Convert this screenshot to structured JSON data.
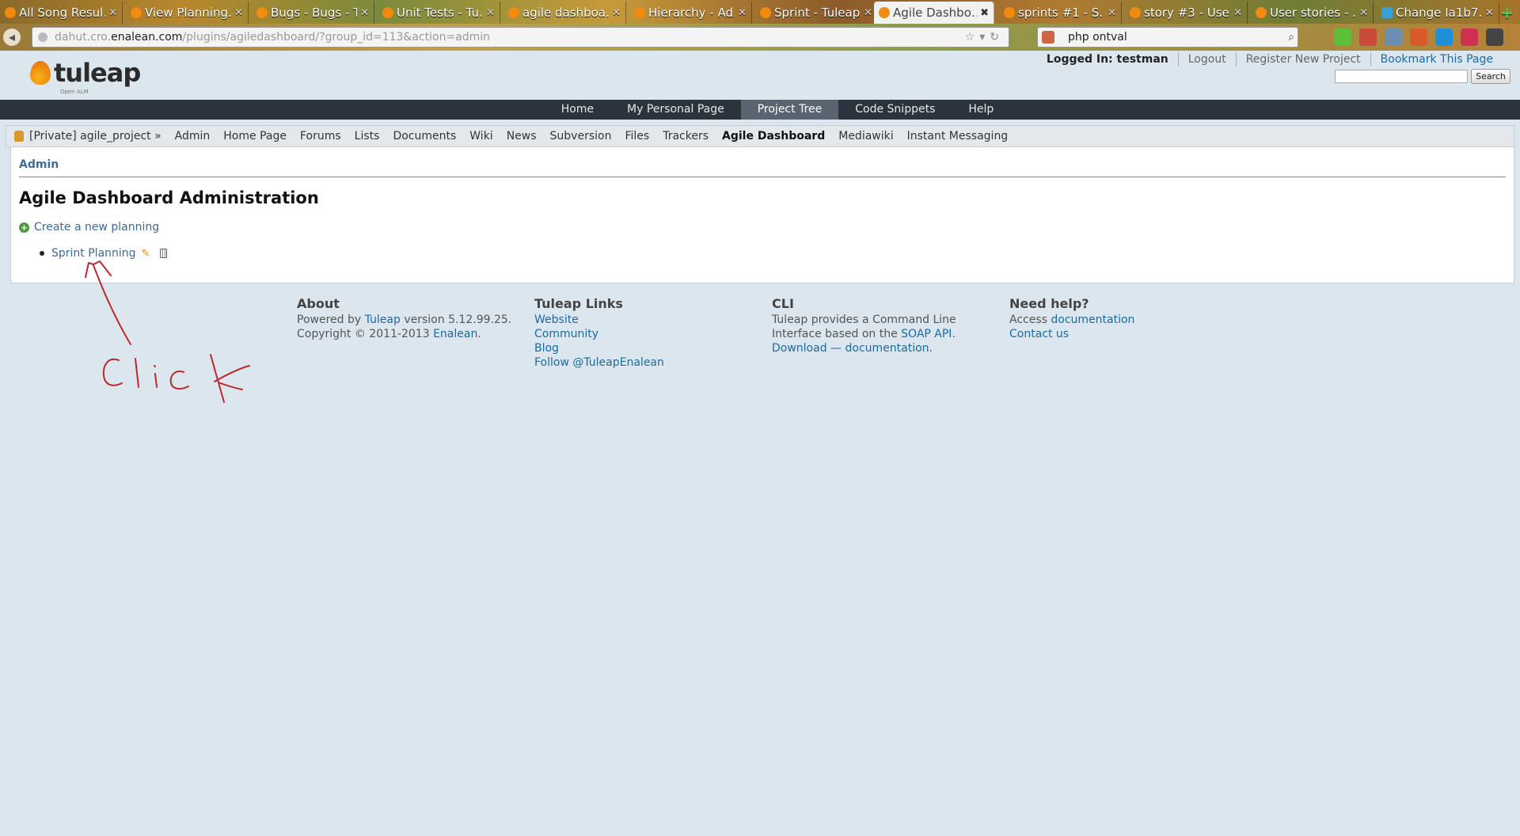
{
  "browser": {
    "tabs": [
      {
        "label": "All Song Resul…"
      },
      {
        "label": "View Planning…"
      },
      {
        "label": "Bugs - Bugs - T…"
      },
      {
        "label": "Unit Tests - Tu…"
      },
      {
        "label": "agile dashboa…"
      },
      {
        "label": "Hierarchy - Ad…"
      },
      {
        "label": "Sprint - Tuleap"
      },
      {
        "label": "Agile Dashbo…",
        "active": true
      },
      {
        "label": "sprints #1 - S…"
      },
      {
        "label": "story #3 - Use…"
      },
      {
        "label": "User stories - …"
      },
      {
        "label": "Change Ia1b7…"
      }
    ],
    "url": {
      "pre": "dahut.cro.",
      "domain": "enalean.com",
      "path": "/plugins/agiledashboard/?group_id=113&action=admin"
    },
    "search_query": "php ontval"
  },
  "header": {
    "logo_text": "tuleap",
    "logo_tagline": "Open ALM",
    "logged_in": "Logged In: testman",
    "logout": "Logout",
    "register": "Register New Project",
    "bookmark": "Bookmark This Page",
    "search_button": "Search"
  },
  "main_nav": [
    {
      "label": "Home"
    },
    {
      "label": "My Personal Page"
    },
    {
      "label": "Project Tree",
      "active": true
    },
    {
      "label": "Code Snippets"
    },
    {
      "label": "Help"
    }
  ],
  "project_nav": {
    "project": "[Private] agile_project »",
    "items": [
      "Admin",
      "Home Page",
      "Forums",
      "Lists",
      "Documents",
      "Wiki",
      "News",
      "Subversion",
      "Files",
      "Trackers",
      "Agile Dashboard",
      "Mediawiki",
      "Instant Messaging"
    ],
    "current": "Agile Dashboard"
  },
  "content": {
    "breadcrumb": "Admin",
    "title": "Agile Dashboard Administration",
    "create_link": "Create a new planning",
    "plannings": [
      "Sprint Planning"
    ]
  },
  "footer": {
    "about": {
      "title": "About",
      "powered_by": "Powered by",
      "tuleap": "Tuleap",
      "version": "version 5.12.99.25.",
      "copyright": "Copyright © 2011-2013",
      "enalean": "Enalean",
      "period": "."
    },
    "links": {
      "title": "Tuleap Links",
      "items": [
        "Website",
        "Community",
        "Blog",
        "Follow @TuleapEnalean"
      ]
    },
    "cli": {
      "title": "CLI",
      "line1": "Tuleap provides a Command Line",
      "line2_pre": "Interface based on the",
      "soap": "SOAP API",
      "dot": ".",
      "download": "Download",
      "dash": "—",
      "documentation": "documentation",
      "dot2": "."
    },
    "help": {
      "title": "Need help?",
      "access": "Access",
      "documentation": "documentation",
      "contact": "Contact us"
    }
  },
  "annotation": {
    "text": "Click",
    "color": "#c0282d"
  }
}
